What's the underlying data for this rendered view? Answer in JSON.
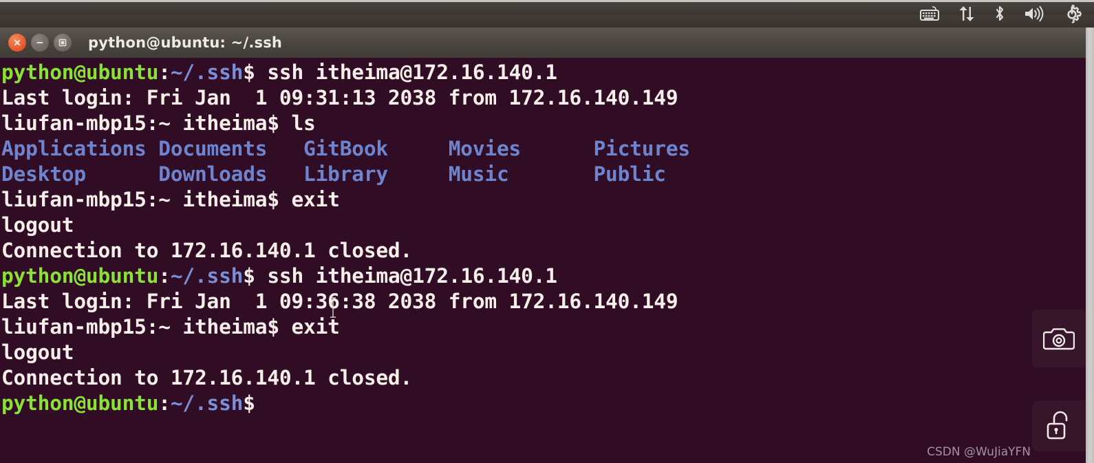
{
  "top_panel": {
    "tray_icons": [
      {
        "name": "keyboard-indicator-icon",
        "label": "Keyboard layout"
      },
      {
        "name": "network-transfer-icon",
        "label": "Network"
      },
      {
        "name": "bluetooth-icon",
        "label": "Bluetooth"
      },
      {
        "name": "volume-icon",
        "label": "Volume"
      },
      {
        "name": "system-settings-gear-icon",
        "label": "System settings"
      }
    ]
  },
  "window": {
    "title": "python@ubuntu: ~/.ssh",
    "controls": {
      "close_label": "Close",
      "minimize_label": "Minimize",
      "maximize_label": "Maximize"
    }
  },
  "terminal": {
    "prompt_user_host": "python@ubuntu",
    "prompt_colon": ":",
    "prompt_path": "~/.ssh",
    "prompt_sigil": "$",
    "remote_prompt": "liufan-mbp15:~ itheima$",
    "lines": [
      {
        "type": "prompt",
        "command": " ssh itheima@172.16.140.1"
      },
      {
        "type": "output",
        "text": "Last login: Fri Jan  1 09:31:13 2038 from 172.16.140.149"
      },
      {
        "type": "remote-prompt",
        "command": " ls"
      },
      {
        "type": "dir-listing",
        "text": "Applications Documents   GitBook     Movies      Pictures"
      },
      {
        "type": "dir-listing",
        "text": "Desktop      Downloads   Library     Music       Public"
      },
      {
        "type": "remote-prompt",
        "command": " exit"
      },
      {
        "type": "output",
        "text": "logout"
      },
      {
        "type": "output",
        "text": "Connection to 172.16.140.1 closed."
      },
      {
        "type": "prompt",
        "command": " ssh itheima@172.16.140.1"
      },
      {
        "type": "output",
        "text": "Last login: Fri Jan  1 09:36:38 2038 from 172.16.140.149"
      },
      {
        "type": "remote-prompt",
        "command": " exit"
      },
      {
        "type": "output",
        "text": "logout"
      },
      {
        "type": "output",
        "text": "Connection to 172.16.140.1 closed."
      },
      {
        "type": "prompt",
        "command": ""
      }
    ],
    "directories": [
      "Applications",
      "Documents",
      "GitBook",
      "Movies",
      "Pictures",
      "Desktop",
      "Downloads",
      "Library",
      "Music",
      "Public"
    ],
    "colors": {
      "background": "#300d24",
      "foreground": "#f2ebe6",
      "prompt_green": "#8ae234",
      "prompt_blue": "#7a8fd8",
      "directory_blue": "#6f84cf"
    }
  },
  "overlays": {
    "camera_icon_name": "camera-icon",
    "lock_icon_name": "unlocked-padlock-icon",
    "watermark": "CSDN @WuJiaYFN"
  }
}
